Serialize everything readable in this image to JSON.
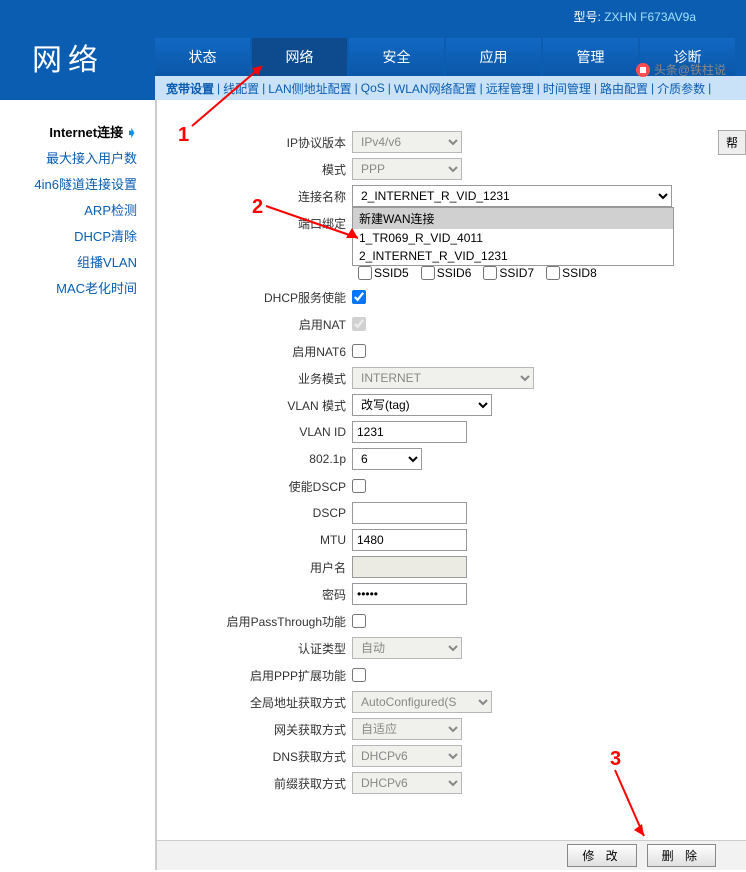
{
  "header": {
    "model_label": "型号:",
    "model_value": "ZXHN F673AV9a",
    "logo": "网络",
    "tabs": [
      "状态",
      "网络",
      "安全",
      "应用",
      "管理",
      "诊断"
    ],
    "active_tab": 1,
    "subnav": [
      "宽带设置",
      "线配置",
      "LAN侧地址配置",
      "QoS",
      "WLAN网络配置",
      "远程管理",
      "时间管理",
      "路由配置",
      "介质参数"
    ],
    "help_btn": "帮"
  },
  "sidebar": {
    "items": [
      "Internet连接",
      "最大接入用户数",
      "4in6隧道连接设置",
      "ARP检测",
      "DHCP清除",
      "组播VLAN",
      "MAC老化时间"
    ],
    "active": 0
  },
  "form": {
    "ip_version": {
      "label": "IP协议版本",
      "value": "IPv4/v6"
    },
    "mode": {
      "label": "模式",
      "value": "PPP"
    },
    "conn_name": {
      "label": "连接名称",
      "value": "2_INTERNET_R_VID_1231",
      "options": [
        "新建WAN连接",
        "1_TR069_R_VID_4011",
        "2_INTERNET_R_VID_1231"
      ]
    },
    "port_bind": {
      "label": "端口绑定"
    },
    "ssids": [
      "SSID5",
      "SSID6",
      "SSID7",
      "SSID8"
    ],
    "dhcp_enable": {
      "label": "DHCP服务使能",
      "checked": true
    },
    "nat": {
      "label": "启用NAT",
      "checked": true
    },
    "nat6": {
      "label": "启用NAT6",
      "checked": false
    },
    "biz_mode": {
      "label": "业务模式",
      "value": "INTERNET"
    },
    "vlan_mode": {
      "label": "VLAN 模式",
      "value": "改写(tag)"
    },
    "vlan_id": {
      "label": "VLAN ID",
      "value": "1231"
    },
    "p8021": {
      "label": "802.1p",
      "value": "6"
    },
    "dscp_en": {
      "label": "使能DSCP",
      "checked": false
    },
    "dscp": {
      "label": "DSCP",
      "value": ""
    },
    "mtu": {
      "label": "MTU",
      "value": "1480"
    },
    "user": {
      "label": "用户名",
      "value": ""
    },
    "pwd": {
      "label": "密码",
      "value": "•••••"
    },
    "passthrough": {
      "label": "启用PassThrough功能",
      "checked": false
    },
    "auth": {
      "label": "认证类型",
      "value": "自动"
    },
    "ppp_ext": {
      "label": "启用PPP扩展功能",
      "checked": false
    },
    "global_addr": {
      "label": "全局地址获取方式",
      "value": "AutoConfigured(S"
    },
    "gateway": {
      "label": "网关获取方式",
      "value": "自适应"
    },
    "dns": {
      "label": "DNS获取方式",
      "value": "DHCPv6"
    },
    "prefix": {
      "label": "前缀获取方式",
      "value": "DHCPv6"
    }
  },
  "buttons": {
    "modify": "修 改",
    "delete": "删 除"
  },
  "annotations": {
    "a1": "1",
    "a2": "2",
    "a3": "3"
  },
  "watermark": "头条@铁柱说"
}
